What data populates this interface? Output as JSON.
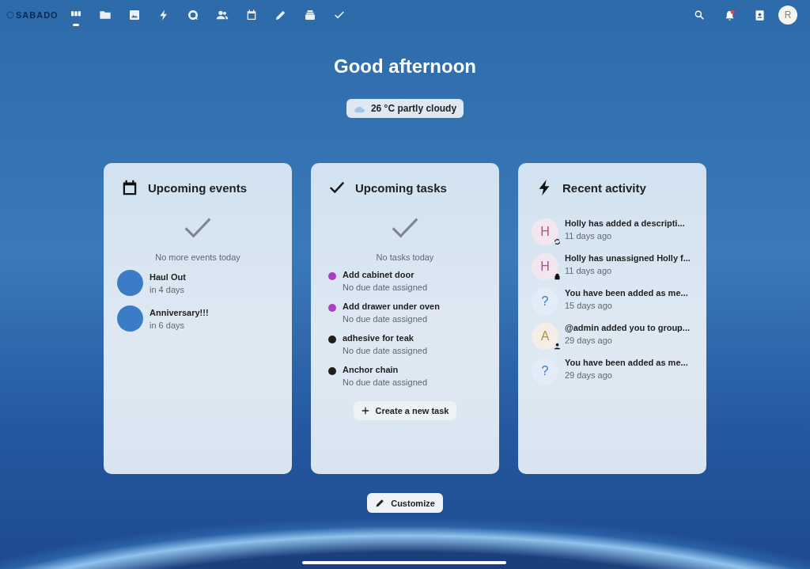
{
  "header": {
    "logo": "SABADO",
    "apps": [
      {
        "kind": "dashboard",
        "selected": true
      },
      {
        "kind": "folder",
        "selected": false
      },
      {
        "kind": "image",
        "selected": false
      },
      {
        "kind": "bolt",
        "selected": false
      },
      {
        "kind": "chat",
        "selected": false
      },
      {
        "kind": "contacts",
        "selected": false
      },
      {
        "kind": "calendar",
        "selected": false
      },
      {
        "kind": "pencil",
        "selected": false
      },
      {
        "kind": "deck",
        "selected": false
      },
      {
        "kind": "check",
        "selected": false
      }
    ],
    "notifications_unread": true,
    "avatar": "R"
  },
  "greeting": "Good afternoon",
  "weather": "26 °C partly cloudy",
  "widgets": [
    {
      "kind": "events",
      "title": "Upcoming events",
      "empty": "No more events today",
      "items": [
        {
          "title": "Haul Out",
          "subtitle": "in 4 days",
          "color": "#3b7cc6"
        },
        {
          "title": "Anniversary!!!",
          "subtitle": "in 6 days",
          "color": "#3b7cc6"
        }
      ]
    },
    {
      "kind": "tasks",
      "title": "Upcoming tasks",
      "empty": "No tasks today",
      "items": [
        {
          "title": "Add cabinet door",
          "subtitle": "No due date assigned",
          "color": "#a93fc4"
        },
        {
          "title": "Add drawer under oven",
          "subtitle": "No due date assigned",
          "color": "#a93fc4"
        },
        {
          "title": "adhesive for teak",
          "subtitle": "No due date assigned",
          "color": "#1f1f1a"
        },
        {
          "title": "Anchor chain",
          "subtitle": "No due date assigned",
          "color": "#1f1f1a"
        }
      ],
      "button": "Create a new task"
    },
    {
      "kind": "activity",
      "title": "Recent activity",
      "items": [
        {
          "avatar": "H",
          "color": "#b0508a",
          "kind": "sync",
          "title": "Holly has added a descripti...",
          "subtitle": "11 days ago"
        },
        {
          "avatar": "H",
          "color": "#b0508a",
          "kind": "lock",
          "title": "Holly has unassigned Holly f...",
          "subtitle": "11 days ago"
        },
        {
          "avatar": "?",
          "color": "#3a7cc8",
          "kind": "plain",
          "title": "You have been added as me...",
          "subtitle": "15 days ago"
        },
        {
          "avatar": "A",
          "color": "#c48a3c",
          "kind": "person",
          "title": "@admin added you to group...",
          "subtitle": "29 days ago"
        },
        {
          "avatar": "?",
          "color": "#3a7cc8",
          "kind": "plain",
          "title": "You have been added as me...",
          "subtitle": "29 days ago"
        }
      ]
    }
  ],
  "customize": "Customize"
}
